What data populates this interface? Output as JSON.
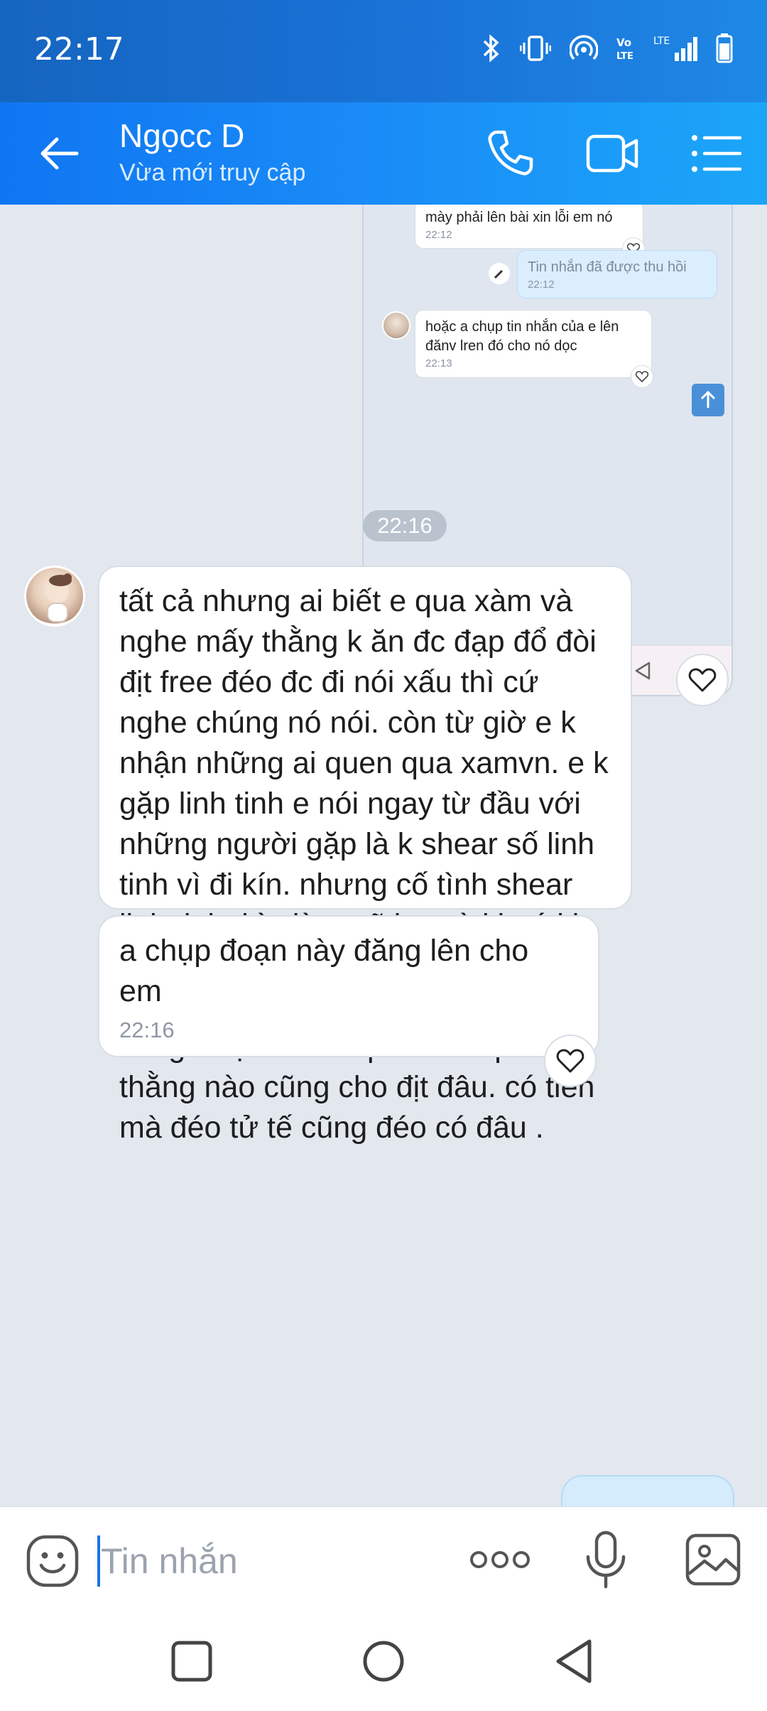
{
  "status_bar": {
    "time": "22:17",
    "icons": [
      "bluetooth-icon",
      "vibrate-icon",
      "hotspot-icon",
      "volte-icon",
      "lte-signal-icon",
      "battery-icon"
    ]
  },
  "header": {
    "contact_name": "Ngọcc D",
    "contact_status": "Vừa mới truy cập",
    "icons": [
      "back-arrow-icon",
      "phone-icon",
      "video-camera-icon",
      "menu-list-icon"
    ]
  },
  "embedded_screenshot": {
    "messages": [
      {
        "text": "mày phải lên bài xin lỗi em nó",
        "time": "22:12"
      },
      {
        "text": "Tin nhắn đã được thu hồi",
        "time": "22:12"
      },
      {
        "text": "hoặc a chụp  tin nhắn của e lên đănv lren đó cho nó dọc",
        "time": "22:13"
      }
    ]
  },
  "chat": {
    "time_separator": "22:16",
    "messages": [
      {
        "text": "tất cả nhưng ai biết e qua xàm và nghe mấy thằng k ăn đc đạp đổ đòi địt free đéo đc đi nói xấu thì cứ nghe chúng nó nói. còn từ giờ e k nhận những ai quen qua xamvn. e k gặp linh tinh e nói ngay từ đầu với những người gặp là k shear số linh tinh vì đi kín. nhưng cố tình shear linh tinh thì giờ e sẽ lọc và khoá kb bằng số lạ k cho tìm nữa. e cũng thay số luôn. có là phò cũng có quy tắc giá trị của con phò. đéo phải thằng nào cũng cho địt đâu. có tiền mà đéo tử tế cũng đéo có đâu ."
      },
      {
        "text": "a chụp đoạn này đăng lên cho em",
        "time": "22:16"
      }
    ]
  },
  "composer": {
    "placeholder": "Tin nhắn",
    "icons": [
      "emoji-icon",
      "more-dots-icon",
      "microphone-icon",
      "image-icon"
    ]
  },
  "colors": {
    "header_start": "#0f76f2",
    "header_end": "#1ba6f8",
    "chat_background": "#e3e8ef",
    "bubble_background": "#ffffff",
    "accent": "#1a73e8"
  }
}
